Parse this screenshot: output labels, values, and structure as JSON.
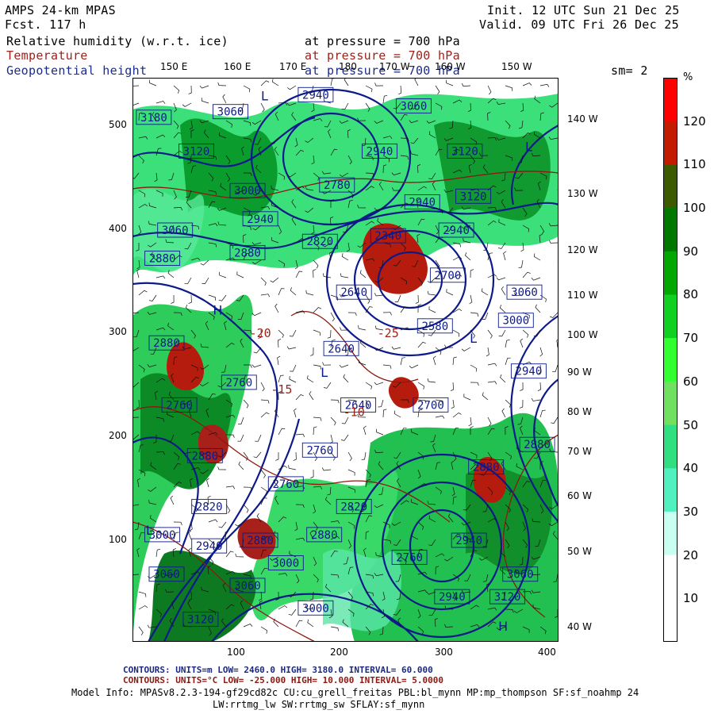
{
  "header": {
    "model": "AMPS 24-km MPAS",
    "fcst": "Fcst. 117 h",
    "init": "Init. 12 UTC Sun 21 Dec 25",
    "valid": "Valid. 09 UTC Fri 26 Dec 25",
    "fields": [
      {
        "name": "Relative humidity (w.r.t. ice)",
        "level": "at pressure =  700 hPa",
        "color": "#000000"
      },
      {
        "name": "Temperature",
        "level": "at pressure =  700 hPa",
        "color": "#a0201a"
      },
      {
        "name": "Geopotential height",
        "level": "at pressure =  700 hPa",
        "color": "#1a2c8a"
      }
    ],
    "smoothing": "sm= 2"
  },
  "map": {
    "top_lon_labels": [
      "150 E",
      "160 E",
      "170 E",
      "180",
      "170 W",
      "160 W",
      "150 W"
    ],
    "right_lon_labels": [
      "140 W",
      "130 W",
      "120 W",
      "110 W",
      "100 W",
      "90 W",
      "80 W",
      "70 W",
      "60 W",
      "50 W",
      "40 W"
    ],
    "x_ticks": [
      "100",
      "200",
      "300",
      "400"
    ],
    "y_ticks": [
      "500",
      "400",
      "300",
      "200",
      "100"
    ],
    "height_labels": [
      {
        "text": "3180",
        "x": 0.05,
        "y": 0.07
      },
      {
        "text": "3060",
        "x": 0.23,
        "y": 0.06
      },
      {
        "text": "2940",
        "x": 0.43,
        "y": 0.03
      },
      {
        "text": "3060",
        "x": 0.66,
        "y": 0.05
      },
      {
        "text": "3120",
        "x": 0.78,
        "y": 0.13
      },
      {
        "text": "3120",
        "x": 0.15,
        "y": 0.13
      },
      {
        "text": "2940",
        "x": 0.58,
        "y": 0.13
      },
      {
        "text": "3000",
        "x": 0.27,
        "y": 0.2
      },
      {
        "text": "2780",
        "x": 0.48,
        "y": 0.19
      },
      {
        "text": "3120",
        "x": 0.8,
        "y": 0.21
      },
      {
        "text": "2940",
        "x": 0.68,
        "y": 0.22
      },
      {
        "text": "2940",
        "x": 0.3,
        "y": 0.25
      },
      {
        "text": "3060",
        "x": 0.1,
        "y": 0.27
      },
      {
        "text": "2880",
        "x": 0.27,
        "y": 0.31
      },
      {
        "text": "2880",
        "x": 0.07,
        "y": 0.32
      },
      {
        "text": "2820",
        "x": 0.44,
        "y": 0.29
      },
      {
        "text": "2340",
        "x": 0.6,
        "y": 0.28
      },
      {
        "text": "2940",
        "x": 0.76,
        "y": 0.27
      },
      {
        "text": "2700",
        "x": 0.74,
        "y": 0.35
      },
      {
        "text": "3060",
        "x": 0.92,
        "y": 0.38
      },
      {
        "text": "2640",
        "x": 0.52,
        "y": 0.38
      },
      {
        "text": "2580",
        "x": 0.71,
        "y": 0.44
      },
      {
        "text": "3000",
        "x": 0.9,
        "y": 0.43
      },
      {
        "text": "2640",
        "x": 0.49,
        "y": 0.48
      },
      {
        "text": "2940",
        "x": 0.93,
        "y": 0.52
      },
      {
        "text": "2880",
        "x": 0.08,
        "y": 0.47
      },
      {
        "text": "2760",
        "x": 0.25,
        "y": 0.54
      },
      {
        "text": "2640",
        "x": 0.53,
        "y": 0.58
      },
      {
        "text": "2700",
        "x": 0.7,
        "y": 0.58
      },
      {
        "text": "2760",
        "x": 0.11,
        "y": 0.58
      },
      {
        "text": "2760",
        "x": 0.44,
        "y": 0.66
      },
      {
        "text": "2880",
        "x": 0.95,
        "y": 0.65
      },
      {
        "text": "2760",
        "x": 0.36,
        "y": 0.72
      },
      {
        "text": "2880",
        "x": 0.17,
        "y": 0.67
      },
      {
        "text": "2820",
        "x": 0.18,
        "y": 0.76
      },
      {
        "text": "2880",
        "x": 0.83,
        "y": 0.69
      },
      {
        "text": "3000",
        "x": 0.07,
        "y": 0.81
      },
      {
        "text": "2820",
        "x": 0.52,
        "y": 0.76
      },
      {
        "text": "2880",
        "x": 0.45,
        "y": 0.81
      },
      {
        "text": "2940",
        "x": 0.18,
        "y": 0.83
      },
      {
        "text": "2880",
        "x": 0.3,
        "y": 0.82
      },
      {
        "text": "2940",
        "x": 0.79,
        "y": 0.82
      },
      {
        "text": "3000",
        "x": 0.36,
        "y": 0.86
      },
      {
        "text": "2760",
        "x": 0.65,
        "y": 0.85
      },
      {
        "text": "3060",
        "x": 0.08,
        "y": 0.88
      },
      {
        "text": "3060",
        "x": 0.27,
        "y": 0.9
      },
      {
        "text": "3060",
        "x": 0.91,
        "y": 0.88
      },
      {
        "text": "2940",
        "x": 0.75,
        "y": 0.92
      },
      {
        "text": "3120",
        "x": 0.88,
        "y": 0.92
      },
      {
        "text": "3120",
        "x": 0.16,
        "y": 0.96
      },
      {
        "text": "3000",
        "x": 0.43,
        "y": 0.94
      }
    ],
    "temp_labels": [
      {
        "text": "-20",
        "x": 0.3,
        "y": 0.46
      },
      {
        "text": "-15",
        "x": 0.35,
        "y": 0.56
      },
      {
        "text": "-25",
        "x": 0.6,
        "y": 0.46
      },
      {
        "text": "-10",
        "x": 0.52,
        "y": 0.6
      }
    ],
    "pressure_centers": [
      {
        "text": "L",
        "x": 0.31,
        "y": 0.04
      },
      {
        "text": "L",
        "x": 0.93,
        "y": 0.13
      },
      {
        "text": "L",
        "x": 0.45,
        "y": 0.53
      },
      {
        "text": "L",
        "x": 0.8,
        "y": 0.47
      },
      {
        "text": "H",
        "x": 0.2,
        "y": 0.42
      },
      {
        "text": "H",
        "x": 0.87,
        "y": 0.98
      },
      {
        "text": "L",
        "x": 0.04,
        "y": 0.81
      }
    ]
  },
  "colorbar": {
    "unit": "%",
    "labels": [
      "120",
      "110",
      "100",
      "90",
      "80",
      "70",
      "60",
      "50",
      "40",
      "30",
      "20",
      "10"
    ],
    "colors": [
      "#ff0000",
      "#c41a00",
      "#3c5a00",
      "#007800",
      "#00a800",
      "#10d020",
      "#30ff30",
      "#70e060",
      "#30e080",
      "#50f0c0",
      "#c8fff0",
      "#ffffff",
      "#ffffff"
    ]
  },
  "footer": {
    "line1": "CONTOURS:  UNITS=m  LOW=  2460.0        HIGH=  3180.0        INTERVAL=  60.000",
    "line2": "CONTOURS:  UNITS=°C  LOW= -25.000        HIGH=  10.000        INTERVAL=  5.0000",
    "line3": "Model Info: MPASv8.2.3-194-gf29cd82c CU:cu_grell_freitas PBL:bl_mynn MP:mp_thompson SF:sf_noahmp 24",
    "line4": "LW:rrtmg_lw SW:rrtmg_sw SFLAY:sf_mynn"
  }
}
